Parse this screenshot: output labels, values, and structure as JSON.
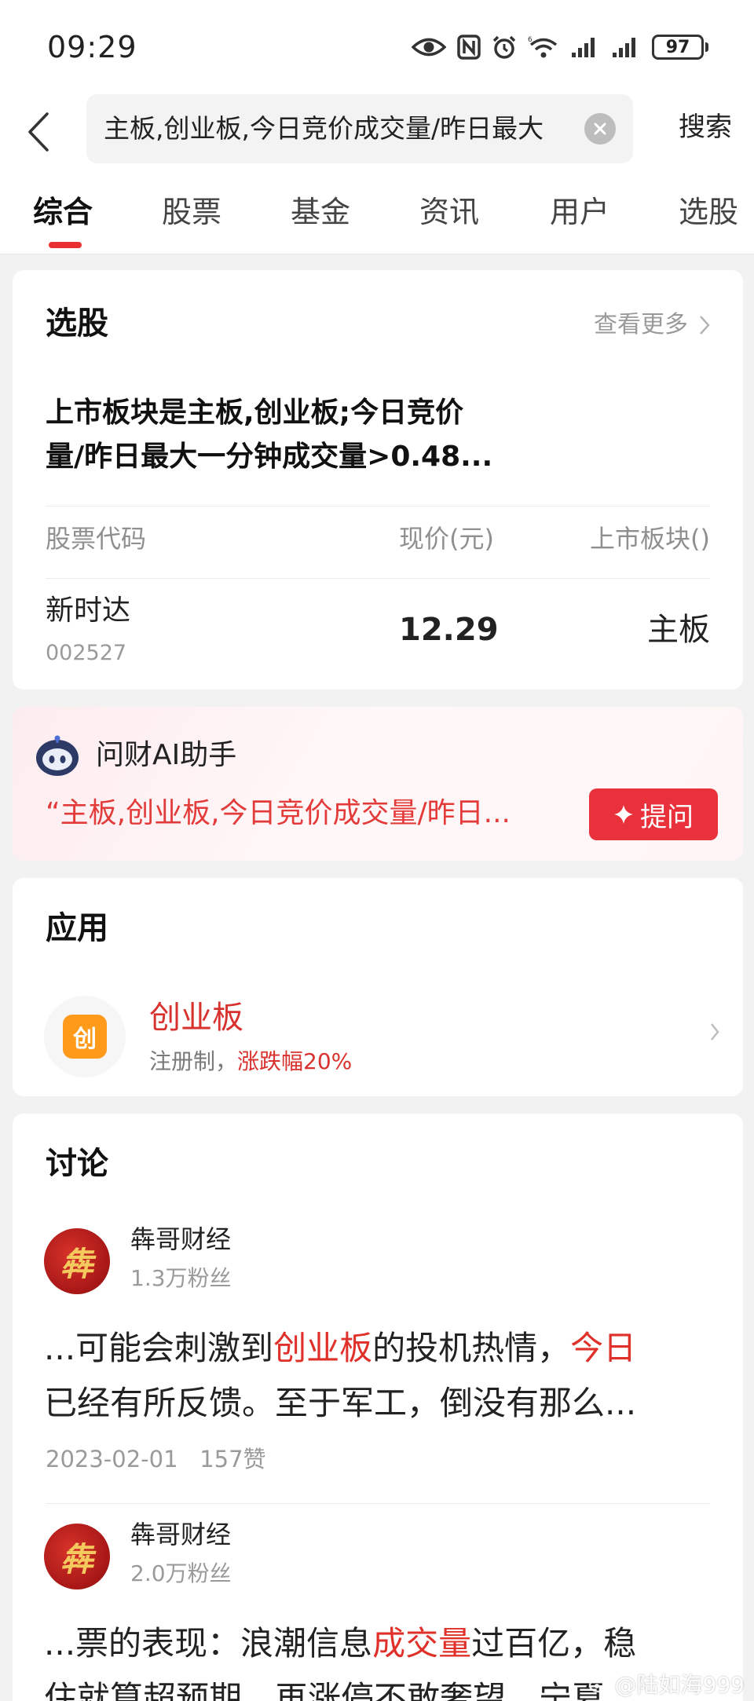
{
  "status_bar": {
    "time": "09:29",
    "battery": "97",
    "icons": [
      "eye-icon",
      "nfc-icon",
      "alarm-icon",
      "wifi-icon",
      "signal-icon",
      "signal-icon",
      "battery-icon"
    ]
  },
  "search": {
    "query": "主板,创业板,今日竞价成交量/昨日最大",
    "button_label": "搜索"
  },
  "tabs": [
    {
      "label": "综合",
      "active": true
    },
    {
      "label": "股票",
      "active": false
    },
    {
      "label": "基金",
      "active": false
    },
    {
      "label": "资讯",
      "active": false
    },
    {
      "label": "用户",
      "active": false
    },
    {
      "label": "选股",
      "active": false
    }
  ],
  "screener": {
    "title": "选股",
    "more_label": "查看更多",
    "condition_line1": "上市板块是主板,创业板;今日竞价",
    "condition_line2": "量/昨日最大一分钟成交量>0.48...",
    "headers": [
      "股票代码",
      "现价(元)",
      "上市板块()"
    ],
    "row": {
      "name": "新时达",
      "code": "002527",
      "price": "12.29",
      "board": "主板"
    }
  },
  "ai_assistant": {
    "title": "问财AI助手",
    "query": "“主板,创业板,今日竞价成交量/昨日...",
    "ask_label": "提问"
  },
  "apps": {
    "title": "应用",
    "item": {
      "icon_char": "创",
      "name": "创业板",
      "desc_prefix": "注册制，",
      "desc_highlight": "涨跌幅20%"
    }
  },
  "discussion": {
    "title": "讨论",
    "posts": [
      {
        "author": "犇哥财经",
        "fans": "1.3万粉丝",
        "avatar_char": "犇",
        "l1_a": "...可能会刺激到",
        "l1_hl": "创业板",
        "l1_b": "的投机热情，",
        "l1_hl2": "今日",
        "line2": "已经有所反馈。至于军工，倒没有那么...",
        "date": "2023-02-01",
        "likes": "157赞"
      },
      {
        "author": "犇哥财经",
        "fans": "2.0万粉丝",
        "avatar_char": "犇",
        "l1_a": "...票的表现：浪潮信息",
        "l1_hl": "成交量",
        "l1_b": "过百亿，稳",
        "line2": "住就算超预期，再涨停不敢奢望，宁夏"
      }
    ]
  },
  "watermark": "@陆如海999",
  "colors": {
    "accent_red": "#e8313b",
    "highlight_red": "#d8322f",
    "app_icon_orange": "#ff9a1a",
    "page_bg": "#f2f2f2"
  }
}
